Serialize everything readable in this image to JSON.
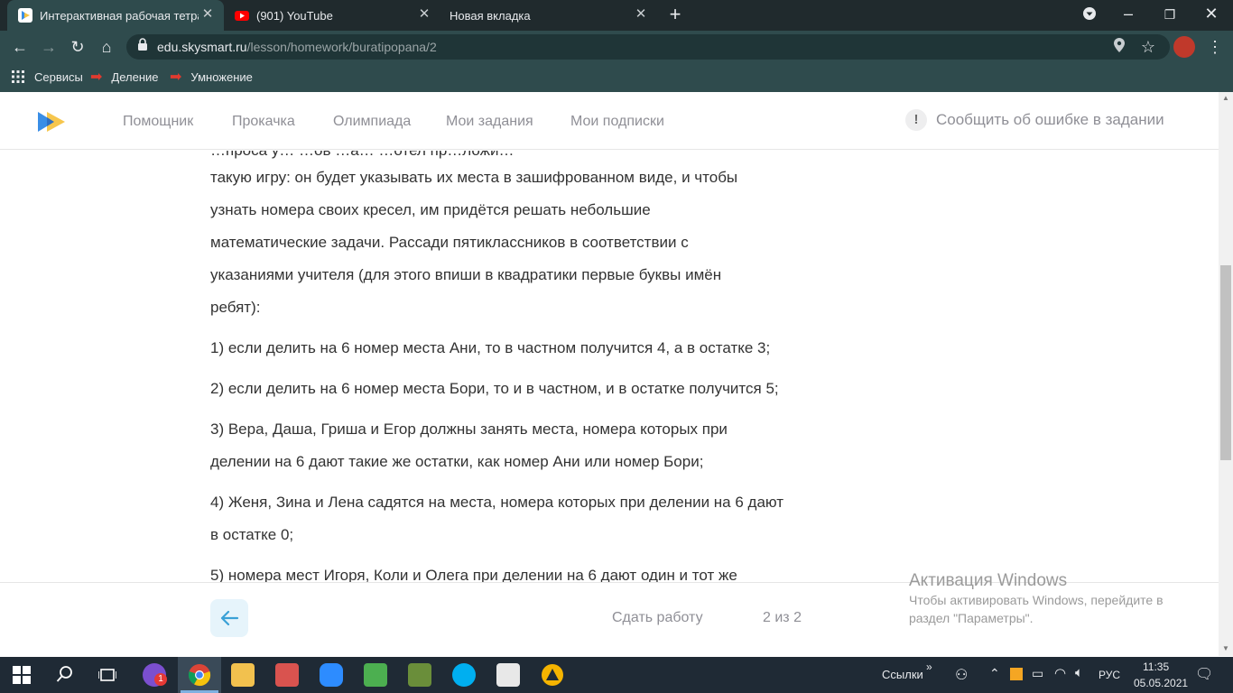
{
  "browser": {
    "tabs": [
      {
        "title": "Интерактивная рабочая тетрадь",
        "active": true
      },
      {
        "title": "(901) YouTube",
        "active": false
      },
      {
        "title": "Новая вкладка",
        "active": false
      }
    ],
    "url": {
      "host": "edu.skysmart.ru",
      "path": "/lesson/homework/buratipopana/2"
    },
    "bookmarks": [
      {
        "label": "Сервисы",
        "icon": "apps-grid-icon"
      },
      {
        "label": "Деление",
        "icon": "red-arrow-icon"
      },
      {
        "label": "Умножение",
        "icon": "red-arrow-icon"
      }
    ]
  },
  "header": {
    "nav": [
      "Помощник",
      "Прокачка",
      "Олимпиада",
      "Мои задания",
      "Мои подписки"
    ],
    "report": "Сообщить об ошибке в задании"
  },
  "content": {
    "intro_cut": "…проса у… …ов …а… …отел пр…ложи…",
    "intro_lines": [
      "такую игру: он будет указывать их места в зашифрованном виде, и чтобы",
      "узнать номера своих кресел, им придётся решать небольшие",
      "математические задачи. Рассади пятиклассников в соответствии с",
      "указаниями учителя (для этого впиши в квадратики первые буквы имён",
      "ребят):"
    ],
    "item1": "1) если делить на 6 номер места Ани, то в частном получится 4, а в остатке 3;",
    "item2": "2) если делить на 6 номер места Бори, то и в частном, и в остатке получится 5;",
    "item3_l1": "3) Вера, Даша, Гриша и Егор должны занять места, номера которых при",
    "item3_l2": "делении на 6 дают такие же остатки, как номер Ани или номер Бори;",
    "item4_l1": "4) Женя, Зина и Лена садятся на места, номера которых при делении на 6 дают",
    "item4_l2": "в остатке 0;",
    "item5_l1": "5) номера мест Игоря, Коли и Олега при делении на 6 дают один и тот же"
  },
  "footer": {
    "submit": "Сдать работу",
    "pages": "2 из 2"
  },
  "watermark": {
    "title": "Активация Windows",
    "line1": "Чтобы активировать Windows, перейдите в",
    "line2": "раздел \"Параметры\"."
  },
  "taskbar": {
    "links_label": "Ссылки",
    "lang": "РУС",
    "time": "11:35",
    "date": "05.05.2021",
    "viber_badge": "1"
  },
  "colors": {
    "chrome_dark": "#202a2d",
    "chrome_toolbar": "#2f4b4d",
    "taskbar": "#1f2a35",
    "text": "#333333",
    "nav": "#8f8f96",
    "accent_blue": "#3a8ee6"
  }
}
